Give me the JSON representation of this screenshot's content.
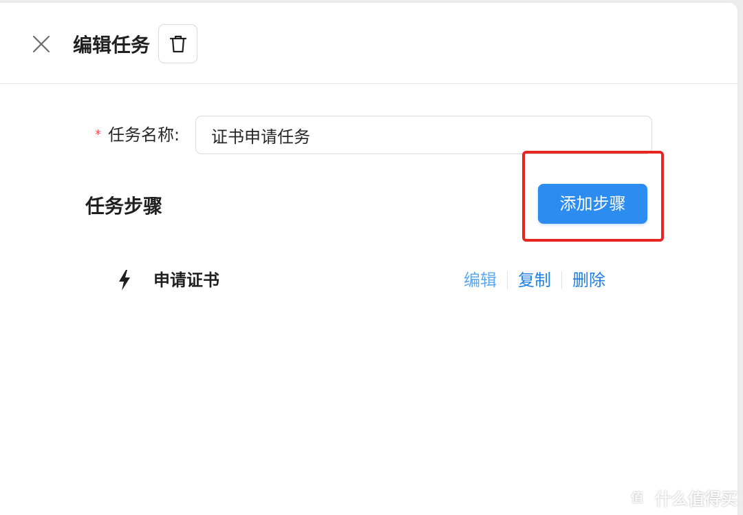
{
  "header": {
    "title": "编辑任务",
    "close_icon": "close-icon",
    "delete_icon": "trash-icon"
  },
  "form": {
    "required_mark": "*",
    "name_label": "任务名称:",
    "name_value": "证书申请任务"
  },
  "steps_section": {
    "title": "任务步骤",
    "add_button_label": "添加步骤",
    "items": [
      {
        "icon": "lightning-icon",
        "name": "申请证书",
        "actions": {
          "edit": "编辑",
          "copy": "复制",
          "delete": "删除"
        }
      }
    ]
  },
  "watermark": {
    "text": "什么值得买",
    "logo": "值"
  },
  "colors": {
    "primary": "#2d8cf0",
    "link": "#1e7fe6",
    "required": "#ff4d4f",
    "highlight": "#e8261f"
  }
}
